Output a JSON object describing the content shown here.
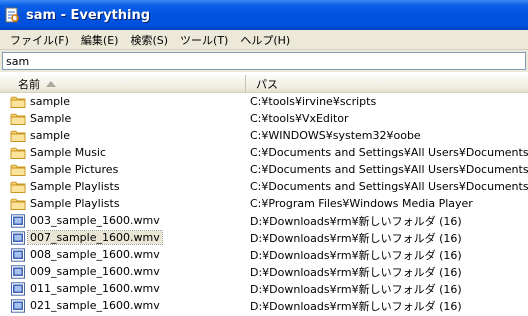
{
  "window": {
    "title": "sam - Everything"
  },
  "menu": {
    "items": [
      {
        "label": "ファイル(F)"
      },
      {
        "label": "編集(E)"
      },
      {
        "label": "検索(S)"
      },
      {
        "label": "ツール(T)"
      },
      {
        "label": "ヘルプ(H)"
      }
    ]
  },
  "search": {
    "value": "sam"
  },
  "columns": {
    "name": "名前",
    "path": "パス",
    "sort": "ascending"
  },
  "rows": [
    {
      "name": "sample",
      "path": "C:¥tools¥irvine¥scripts",
      "icon": "folder-icon"
    },
    {
      "name": "Sample",
      "path": "C:¥tools¥VxEditor",
      "icon": "folder-icon"
    },
    {
      "name": "sample",
      "path": "C:¥WINDOWS¥system32¥oobe",
      "icon": "folder-icon"
    },
    {
      "name": "Sample Music",
      "path": "C:¥Documents and Settings¥All Users¥Documents¥My",
      "icon": "folder-icon"
    },
    {
      "name": "Sample Pictures",
      "path": "C:¥Documents and Settings¥All Users¥Documents¥My",
      "icon": "folder-icon"
    },
    {
      "name": "Sample Playlists",
      "path": "C:¥Documents and Settings¥All Users¥Documents¥My",
      "icon": "folder-icon"
    },
    {
      "name": "Sample Playlists",
      "path": "C:¥Program Files¥Windows Media Player",
      "icon": "folder-icon"
    },
    {
      "name": "003_sample_1600.wmv",
      "path": "D:¥Downloads¥rm¥新しいフォルダ (16)",
      "icon": "video-file-icon"
    },
    {
      "name": "007_sample_1600.wmv",
      "path": "D:¥Downloads¥rm¥新しいフォルダ (16)",
      "icon": "video-file-icon",
      "selected": true
    },
    {
      "name": "008_sample_1600.wmv",
      "path": "D:¥Downloads¥rm¥新しいフォルダ (16)",
      "icon": "video-file-icon"
    },
    {
      "name": "009_sample_1600.wmv",
      "path": "D:¥Downloads¥rm¥新しいフォルダ (16)",
      "icon": "video-file-icon"
    },
    {
      "name": "011_sample_1600.wmv",
      "path": "D:¥Downloads¥rm¥新しいフォルダ (16)",
      "icon": "video-file-icon"
    },
    {
      "name": "021_sample_1600.wmv",
      "path": "D:¥Downloads¥rm¥新しいフォルダ (16)",
      "icon": "video-file-icon"
    }
  ]
}
